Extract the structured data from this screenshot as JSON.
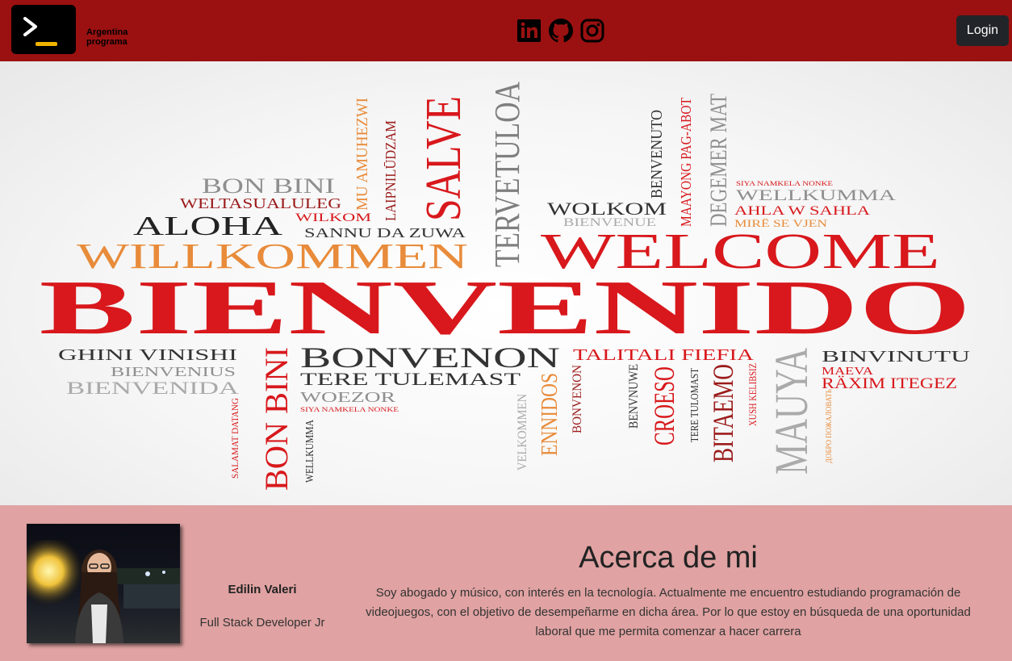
{
  "header": {
    "brand_line1": "Argentina",
    "brand_line2": "programa",
    "socials": [
      "linkedin-icon",
      "github-icon",
      "instagram-icon"
    ],
    "login_label": "Login",
    "bg_color": "#9b1111"
  },
  "hero": {
    "words": {
      "bienvenido": "BIENVENIDO",
      "welcome": "WELCOME",
      "willkommen": "WILLKOMMEN",
      "aloha": "ALOHA",
      "bon_bini": "BON BINI",
      "weltasualuleg": "WELTASUALULEG",
      "wilkom": "WILKOM",
      "sannu": "SANNU DA ZUWA",
      "salve": "SALVE",
      "tervetuloa": "TERVETULOA",
      "mu_amuhezwi": "MU AMUHEZWI",
      "laipnildzam": "LAIPNILŪDZAM",
      "wolkom": "WOLKOM",
      "bienvenue": "BIENVENUE",
      "benvenuto": "BENVENUTO",
      "maayong": "MAAYONG PAG-ABOT",
      "degemer": "DEGEMER MAT",
      "siyanamkela": "SIYA NAMKELA NONKE",
      "wellkumma": "WELLKUMMA",
      "ahla": "AHLA W SAHLA",
      "mire": "MIRË SE VJEN",
      "ghini": "GHINI VINISHI",
      "bienvenius": "BIENVENIUS",
      "bienvenida": "BIENVENIDA",
      "bonvenon": "BONVENON",
      "tere": "TERE TULEMAST",
      "woezor": "WOEZOR",
      "siyanamkela2": "SIYA NAMKELA NONKE",
      "talitali": "TALITALI FIEFIA",
      "binvinutu": "BINVINUTU",
      "maeva": "MAEVA",
      "raxim": "RÄXIM ITEGEZ",
      "salamat": "SALAMAT DATANG",
      "bon_bini2": "BON BINI",
      "wellkumma2": "WELLKUMMA",
      "velkommen": "VELKOMMEN",
      "ennidos": "ENNIDOS",
      "bonvenon2": "BONVENON",
      "bennvenuwe": "BENVNUWE",
      "croeso": "CROESO",
      "tere2": "TERE TULOMAST",
      "bitaemo": "BITAEMO",
      "xush": "XUSH KELIBSIZ",
      "mauya": "MAUYA",
      "dobropozhalovat": "ДОБРО ПОЖАЛОВАТЬ"
    }
  },
  "about": {
    "name": "Edilin Valeri",
    "role": "Full Stack Developer Jr",
    "title": "Acerca de mi",
    "text": "Soy abogado y músico, con interés en la tecnología. Actualmente me encuentro estudiando programación de videojuegos, con el objetivo de desempeñarme en dicha área. Por lo que estoy en búsqueda de una oportunidad laboral que me permita comenzar a hacer carrera",
    "bg_color": "#e0a2a2"
  }
}
